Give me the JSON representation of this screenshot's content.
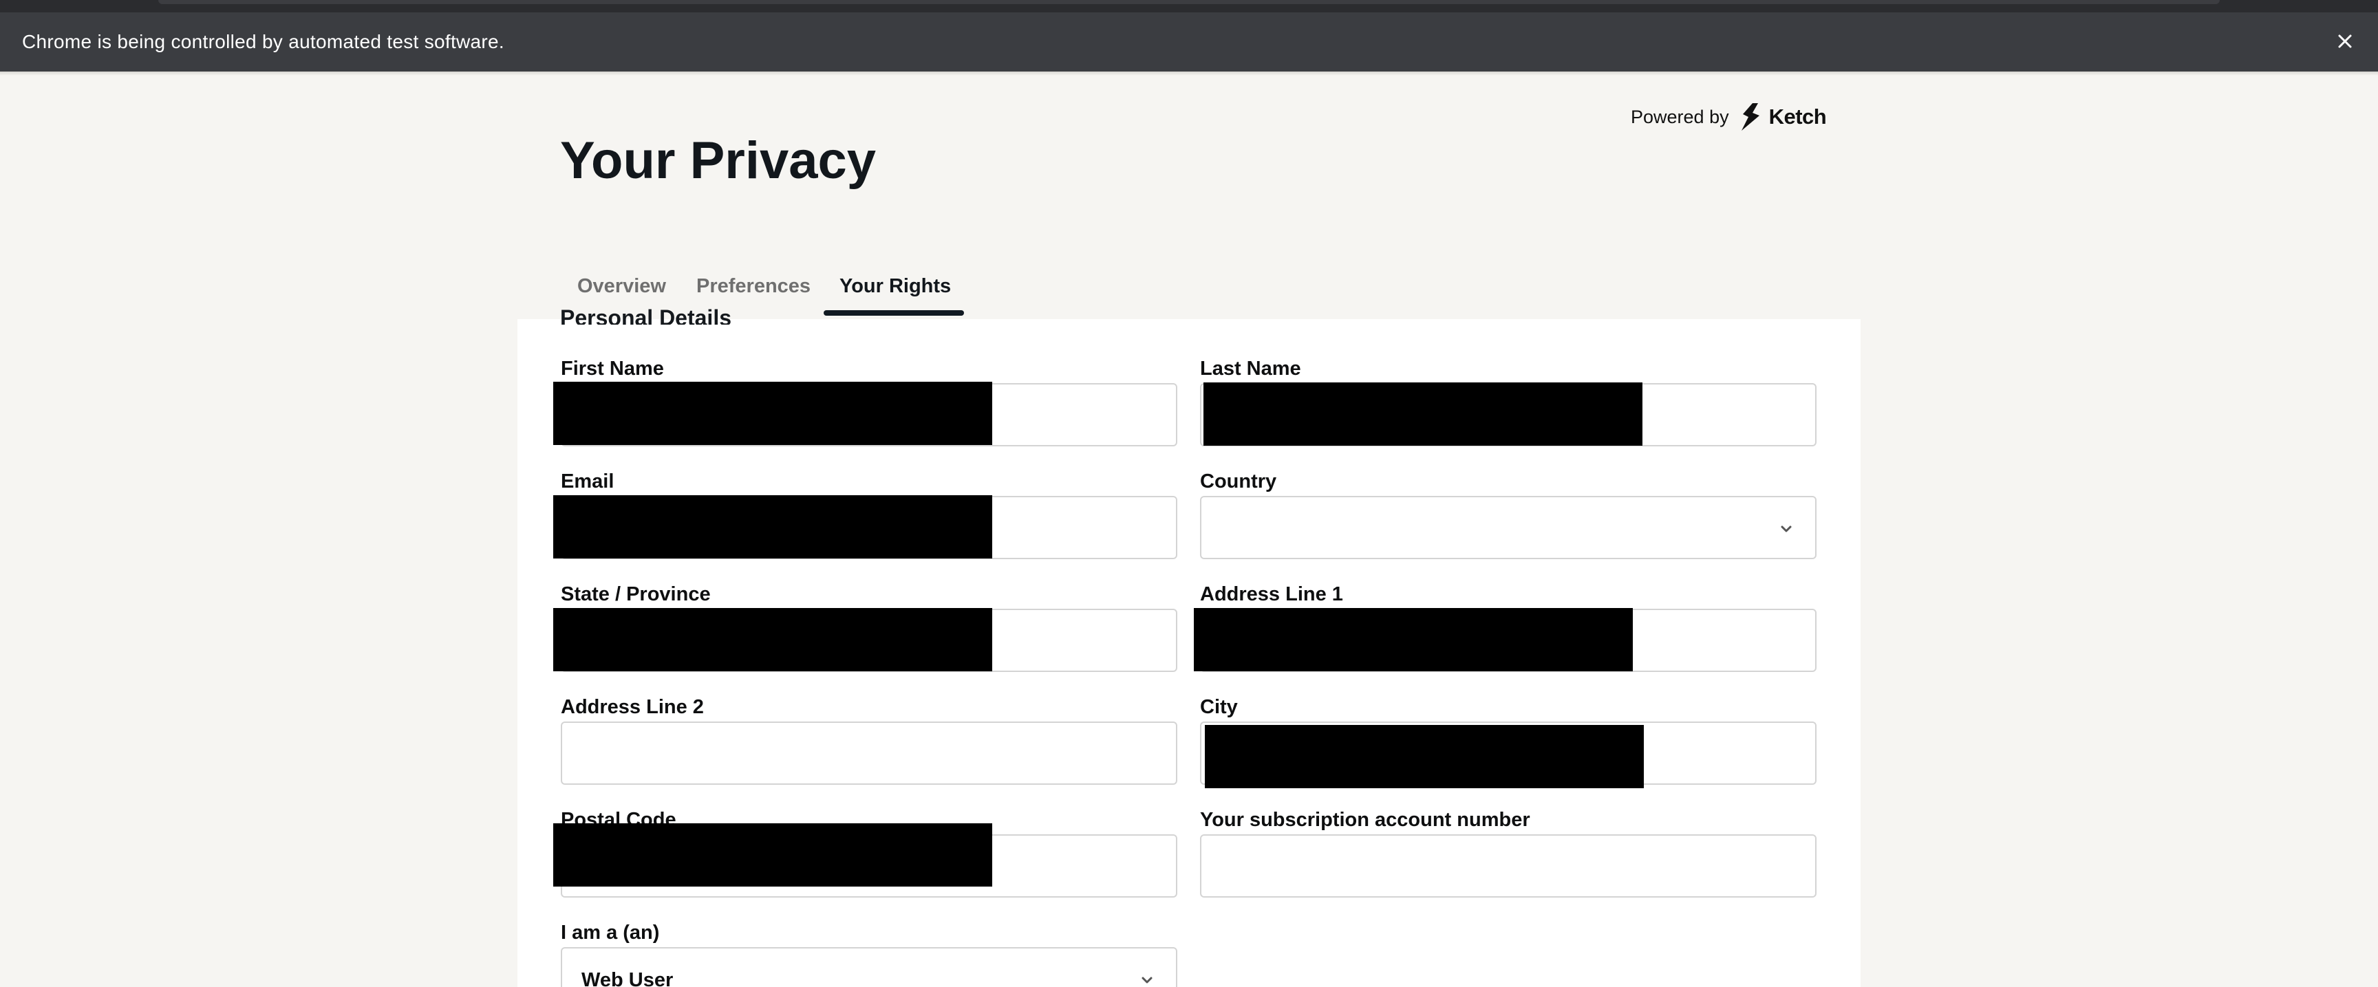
{
  "browser": {
    "automation_banner": "Chrome is being controlled by automated test software."
  },
  "header": {
    "title": "Your Privacy",
    "powered_by": "Powered by",
    "brand": "Ketch"
  },
  "tabs": [
    {
      "label": "Overview",
      "active": false
    },
    {
      "label": "Preferences",
      "active": false
    },
    {
      "label": "Your Rights",
      "active": true
    }
  ],
  "form": {
    "section_title": "Personal Details",
    "fields": {
      "first_name": {
        "label": "First Name",
        "value": "",
        "redacted": true
      },
      "last_name": {
        "label": "Last Name",
        "value": "",
        "redacted": true
      },
      "email": {
        "label": "Email",
        "value": "",
        "redacted": true
      },
      "country": {
        "label": "Country",
        "value": ""
      },
      "state": {
        "label": "State / Province",
        "value": "",
        "redacted": true
      },
      "address1": {
        "label": "Address Line 1",
        "value": "",
        "redacted": true
      },
      "address2": {
        "label": "Address Line 2",
        "value": ""
      },
      "city": {
        "label": "City",
        "value": "",
        "redacted": true
      },
      "postal": {
        "label": "Postal Code",
        "value": "",
        "redacted": true
      },
      "subscription": {
        "label": "Your subscription account number",
        "value": ""
      },
      "user_type": {
        "label": "I am a (an)",
        "value": "Web User"
      }
    }
  },
  "colors": {
    "page_background": "#f6f5f2",
    "banner_background": "#3b3d41",
    "title_text": "#12171c",
    "active_tab_underline": "#111a22",
    "inactive_tab_text": "#6f6f6f"
  }
}
